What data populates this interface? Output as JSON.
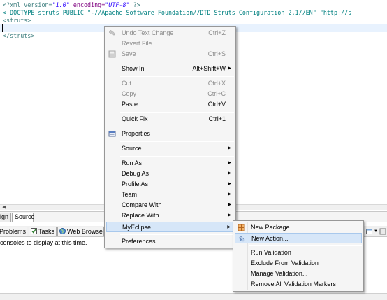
{
  "editor": {
    "lines": [
      {
        "p1": "<?xml version=",
        "p2": "\"1.0\"",
        "p3": " encoding=",
        "p4": "\"UTF-8\"",
        "p5": " ?>"
      },
      {
        "text": "<!DOCTYPE struts PUBLIC \"-//Apache Software Foundation//DTD Struts Configuration 2.1//EN\" \"http://s"
      },
      {
        "text": "<struts>"
      },
      {
        "text": ""
      },
      {
        "text": "</struts>"
      }
    ],
    "tabs": {
      "design": "ign",
      "source": "Source"
    }
  },
  "views": {
    "tabs": [
      {
        "label": "Problems",
        "icon": "problems-icon"
      },
      {
        "label": "Tasks",
        "icon": "tasks-icon"
      },
      {
        "label": "Web Browse",
        "icon": "globe-icon"
      }
    ],
    "console_message": "consoles to display at this time."
  },
  "context_menu": {
    "items": [
      {
        "label": "Undo Text Change",
        "accel": "Ctrl+Z",
        "enabled": false,
        "icon": "undo-icon"
      },
      {
        "label": "Revert File",
        "accel": "",
        "enabled": false
      },
      {
        "label": "Save",
        "accel": "Ctrl+S",
        "enabled": false,
        "icon": "save-icon"
      },
      {
        "label": "Show In",
        "accel": "Alt+Shift+W",
        "submenu": true
      },
      {
        "label": "Cut",
        "accel": "Ctrl+X",
        "enabled": false
      },
      {
        "label": "Copy",
        "accel": "Ctrl+C",
        "enabled": false
      },
      {
        "label": "Paste",
        "accel": "Ctrl+V",
        "enabled": true
      },
      {
        "label": "Quick Fix",
        "accel": "Ctrl+1",
        "enabled": true
      },
      {
        "label": "Properties",
        "accel": "",
        "enabled": true,
        "icon": "properties-icon"
      },
      {
        "label": "Source",
        "submenu": true
      },
      {
        "label": "Run As",
        "submenu": true
      },
      {
        "label": "Debug As",
        "submenu": true
      },
      {
        "label": "Profile As",
        "submenu": true
      },
      {
        "label": "Team",
        "submenu": true
      },
      {
        "label": "Compare With",
        "submenu": true
      },
      {
        "label": "Replace With",
        "submenu": true
      },
      {
        "label": "MyEclipse",
        "submenu": true,
        "highlighted": true
      },
      {
        "label": "Preferences..."
      }
    ]
  },
  "submenu": {
    "items": [
      {
        "label": "New Package...",
        "icon": "package-icon"
      },
      {
        "label": "New Action...",
        "icon": "action-icon",
        "highlighted": true
      },
      {
        "label": "Run Validation"
      },
      {
        "label": "Exclude From Validation"
      },
      {
        "label": "Manage Validation..."
      },
      {
        "label": "Remove All Validation Markers"
      }
    ]
  },
  "colors": {
    "menu_background": "#f5f5f5",
    "highlight": "#d6e6f8",
    "disabled_text": "#8d8d8d",
    "xml_tag": "#3f7f7f",
    "xml_attribute": "#7f007f",
    "xml_string": "#2a00ff",
    "current_line": "#e8f2fe"
  }
}
